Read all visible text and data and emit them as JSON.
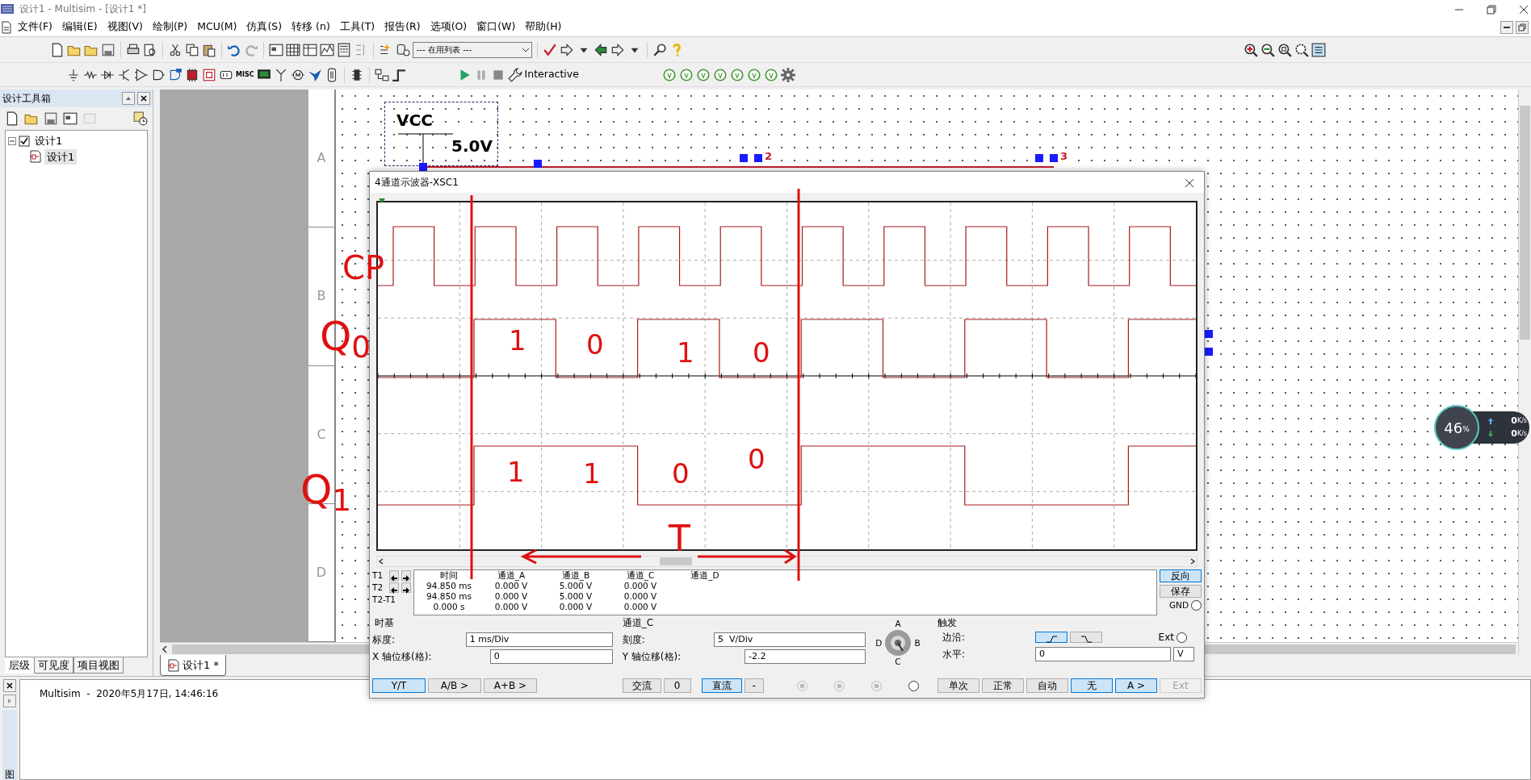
{
  "window": {
    "title": "设计1 - Multisim - [设计1 *]"
  },
  "menu": [
    "文件(F)",
    "编辑(E)",
    "视图(V)",
    "绘制(P)",
    "MCU(M)",
    "仿真(S)",
    "转移 (n)",
    "工具(T)",
    "报告(R)",
    "选项(O)",
    "窗口(W)",
    "帮助(H)"
  ],
  "toolbar": {
    "list_dropdown": "--- 在用列表 ---",
    "misc_label": "MISC",
    "sim_mode": "Interactive"
  },
  "toolbox": {
    "title": "设计工具箱",
    "tree": [
      {
        "label": "设计1",
        "checked": true,
        "expanded": true,
        "selected": false,
        "children": [
          {
            "label": "设计1",
            "selected": true
          }
        ]
      }
    ],
    "tabs": [
      {
        "label": "层级",
        "selected": true
      },
      {
        "label": "可见度",
        "selected": false
      },
      {
        "label": "项目视图",
        "selected": false
      }
    ]
  },
  "schematic": {
    "row_labels": [
      "A",
      "B",
      "C",
      "D"
    ],
    "vcc_label": "VCC",
    "vcc_value": "5.0V",
    "pin_labels": [
      "2",
      "3"
    ],
    "doc_tab": "设计1 *"
  },
  "output": {
    "log": "Multisim  -  2020年5月17日, 14:46:16",
    "side_tab": "图"
  },
  "scope": {
    "title": "4通道示波器-XSC1",
    "readout": {
      "columns": [
        "时间",
        "通道_A",
        "通道_B",
        "通道_C",
        "通道_D"
      ],
      "rows": [
        {
          "label": "T1",
          "cells": [
            "94.850 ms",
            "0.000 V",
            "5.000 V",
            "0.000 V"
          ]
        },
        {
          "label": "T2",
          "cells": [
            "94.850 ms",
            "0.000 V",
            "5.000 V",
            "0.000 V"
          ]
        },
        {
          "label": "T2-T1",
          "cells": [
            "0.000 s",
            "0.000 V",
            "0.000 V",
            "0.000 V"
          ]
        }
      ]
    },
    "side_buttons": [
      {
        "label": "反向",
        "selected": true
      },
      {
        "label": "保存",
        "selected": false
      }
    ],
    "gnd_label": "GND",
    "gnd_checked": false,
    "timebase": {
      "title": "时基",
      "scale_label": "标度:",
      "scale": "1 ms/Div",
      "xpos_label": "X 轴位移(格):",
      "xpos": "0",
      "modes": [
        {
          "label": "Y/T",
          "selected": true
        },
        {
          "label": "A/B >",
          "selected": false
        },
        {
          "label": "A+B >",
          "selected": false
        }
      ]
    },
    "channel": {
      "title": "通道_C",
      "scale_label": "刻度:",
      "scale": "5  V/Div",
      "ypos_label": "Y 轴位移(格):",
      "ypos": "-2.2",
      "coupling": [
        {
          "label": "交流",
          "selected": false
        },
        {
          "label": "0",
          "selected": false
        },
        {
          "label": "直流",
          "selected": true
        },
        {
          "label": "-",
          "selected": false
        }
      ],
      "radios": [
        {
          "disabled": true
        },
        {
          "disabled": true
        },
        {
          "disabled": true
        },
        {
          "disabled": false
        }
      ],
      "knob_labels": [
        "A",
        "B",
        "C",
        "D"
      ]
    },
    "trigger": {
      "title": "触发",
      "edge_label": "边沿:",
      "edges": [
        {
          "kind": "rising",
          "selected": true
        },
        {
          "kind": "falling",
          "selected": false
        }
      ],
      "ext_label": "Ext",
      "ext_checked": false,
      "level_label": "水平:",
      "level": "0",
      "level_unit": "V",
      "modes": [
        {
          "label": "单次",
          "selected": false,
          "disabled": false
        },
        {
          "label": "正常",
          "selected": false,
          "disabled": false
        },
        {
          "label": "自动",
          "selected": false,
          "disabled": false
        },
        {
          "label": "无",
          "selected": true,
          "disabled": false
        },
        {
          "label": "A >",
          "selected": true,
          "disabled": false
        },
        {
          "label": "Ext",
          "selected": false,
          "disabled": true
        }
      ]
    }
  },
  "annotations": [
    "CP",
    "Q$_{0}$",
    "Q$_{1}$",
    "1",
    "0",
    "1",
    "0",
    "1",
    "1",
    "0",
    "0",
    "T"
  ],
  "net_monitor": {
    "percent": "46",
    "percent_unit": "%",
    "up": "0",
    "up_unit": "K/s",
    "down": "0",
    "down_unit": "K/s"
  }
}
